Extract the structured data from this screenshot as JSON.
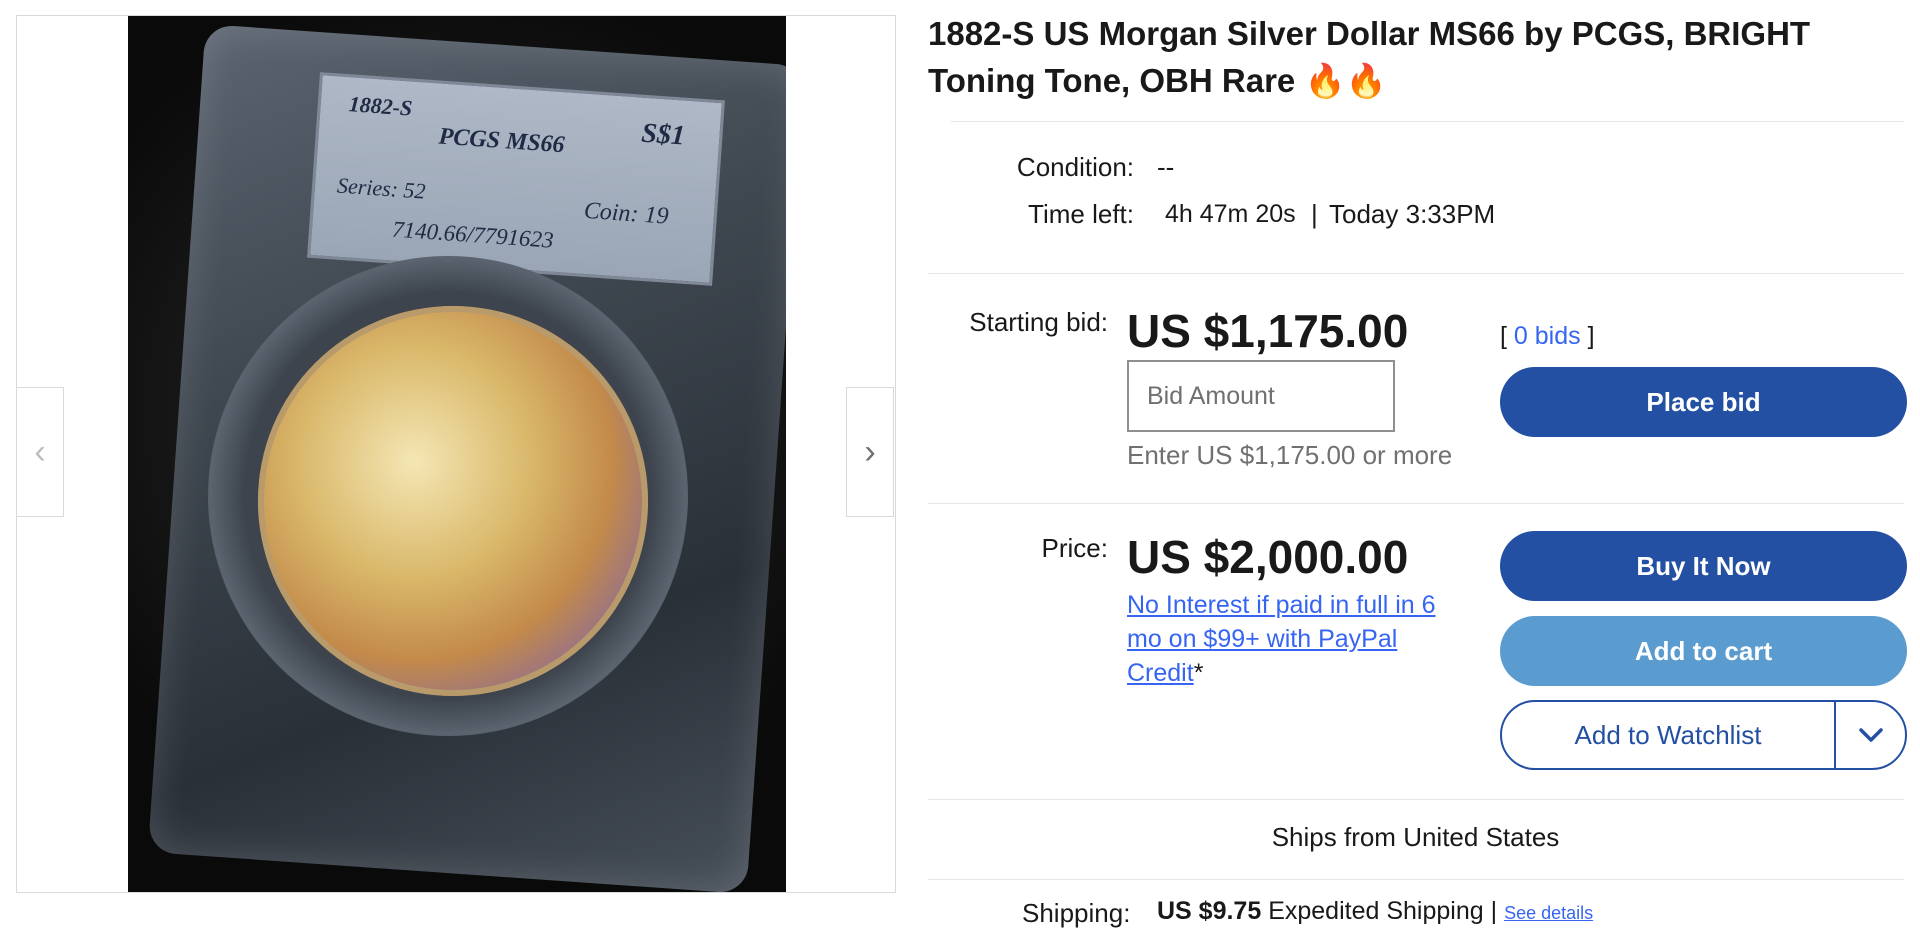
{
  "gallery": {
    "prev_icon": "‹",
    "next_icon": "›",
    "image_label": {
      "year": "1882-S",
      "denomination": "S$1",
      "grade": "PCGS MS66",
      "series": "Series: 52",
      "coin": "Coin: 19",
      "cert": "7140.66/7791623"
    }
  },
  "listing": {
    "title": "1882-S US Morgan Silver Dollar MS66 by PCGS, BRIGHT Toning Tone, OBH Rare 🔥🔥"
  },
  "details": {
    "condition_label": "Condition:",
    "condition_value": "--",
    "time_left_label": "Time left:",
    "time_left_value": "4h 47m 20s",
    "time_separator": "|",
    "end_time": "Today 3:33PM"
  },
  "auction": {
    "starting_bid_label": "Starting bid:",
    "starting_bid_value": "US $1,175.00",
    "bid_placeholder": "Bid Amount",
    "bid_hint": "Enter US $1,175.00 or more",
    "bids_open": "[",
    "bids_count": "0 bids",
    "bids_close": "]",
    "place_bid_label": "Place bid"
  },
  "buy_now": {
    "price_label": "Price:",
    "price_value": "US $2,000.00",
    "credit_text": "No Interest if paid in full in 6 mo on $99+ with PayPal Credit",
    "credit_asterisk": "*",
    "buy_it_now_label": "Buy It Now",
    "add_to_cart_label": "Add to cart",
    "watchlist_label": "Add to Watchlist",
    "watchlist_dropdown_icon": "chevron-down-icon"
  },
  "shipping": {
    "ships_from": "Ships from United States",
    "label": "Shipping:",
    "cost": "US $9.75",
    "method": "Expedited Shipping",
    "separator": "|",
    "details_link": "See details"
  },
  "colors": {
    "primary_button": "#2350a3",
    "cart_button": "#5a9bd0",
    "link": "#3665f3"
  }
}
